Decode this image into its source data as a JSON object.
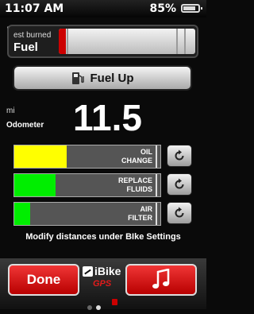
{
  "status": {
    "time": "11:07 AM",
    "battery": "85%"
  },
  "fuel": {
    "caption": "est burned",
    "title": "Fuel",
    "burned_fraction": 0.05
  },
  "buttons": {
    "fuel_up": "Fuel Up",
    "done": "Done"
  },
  "odometer": {
    "unit": "mi",
    "label": "Odometer",
    "value": "11.5"
  },
  "service_items": [
    {
      "label": "OIL\nCHANGE",
      "progress": 0.36,
      "color": "#ffff00"
    },
    {
      "label": "REPLACE\nFLUIDS",
      "progress": 0.28,
      "color": "#00ee00"
    },
    {
      "label": "AIR\nFILTER",
      "progress": 0.11,
      "color": "#00ee00"
    }
  ],
  "note": "Modify distances under BIke Settings",
  "logo": {
    "name": "iBike",
    "sub": "GPS"
  },
  "icons": {
    "pump": "fuel-pump-icon",
    "reset": "refresh-icon",
    "music": "music-note-icon",
    "trash": "trash-icon"
  }
}
